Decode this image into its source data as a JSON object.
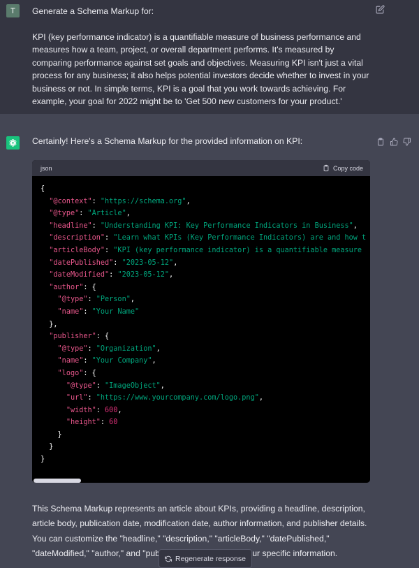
{
  "user": {
    "avatar_letter": "T",
    "title": "Generate a Schema Markup for:",
    "body": "KPI (key performance indicator) is a quantifiable measure of business performance and measures how a team, project, or overall department performs. It's measured by comparing performance against set goals and objectives. Measuring KPI isn't just a vital process for any business; it also helps potential investors decide whether to invest in your business or not. In simple terms, KPI is a goal that you work towards achieving. For example, your goal for 2022 might be to 'Get 500 new customers for your product.'"
  },
  "assistant": {
    "intro": "Certainly! Here's a Schema Markup for the provided information on KPI:",
    "code_language": "json",
    "copy_label": "Copy code",
    "code_lines": [
      [
        [
          "p",
          "{"
        ]
      ],
      [
        [
          "p",
          "  "
        ],
        [
          "k",
          "\"@context\""
        ],
        [
          "p",
          ": "
        ],
        [
          "s",
          "\"https://schema.org\""
        ],
        [
          "p",
          ","
        ]
      ],
      [
        [
          "p",
          "  "
        ],
        [
          "k",
          "\"@type\""
        ],
        [
          "p",
          ": "
        ],
        [
          "s",
          "\"Article\""
        ],
        [
          "p",
          ","
        ]
      ],
      [
        [
          "p",
          "  "
        ],
        [
          "k",
          "\"headline\""
        ],
        [
          "p",
          ": "
        ],
        [
          "s",
          "\"Understanding KPI: Key Performance Indicators in Business\""
        ],
        [
          "p",
          ","
        ]
      ],
      [
        [
          "p",
          "  "
        ],
        [
          "k",
          "\"description\""
        ],
        [
          "p",
          ": "
        ],
        [
          "s",
          "\"Learn what KPIs (Key Performance Indicators) are and how t"
        ]
      ],
      [
        [
          "p",
          "  "
        ],
        [
          "k",
          "\"articleBody\""
        ],
        [
          "p",
          ": "
        ],
        [
          "s",
          "\"KPI (key performance indicator) is a quantifiable measure"
        ]
      ],
      [
        [
          "p",
          "  "
        ],
        [
          "k",
          "\"datePublished\""
        ],
        [
          "p",
          ": "
        ],
        [
          "s",
          "\"2023-05-12\""
        ],
        [
          "p",
          ","
        ]
      ],
      [
        [
          "p",
          "  "
        ],
        [
          "k",
          "\"dateModified\""
        ],
        [
          "p",
          ": "
        ],
        [
          "s",
          "\"2023-05-12\""
        ],
        [
          "p",
          ","
        ]
      ],
      [
        [
          "p",
          "  "
        ],
        [
          "k",
          "\"author\""
        ],
        [
          "p",
          ": {"
        ]
      ],
      [
        [
          "p",
          "    "
        ],
        [
          "k",
          "\"@type\""
        ],
        [
          "p",
          ": "
        ],
        [
          "s",
          "\"Person\""
        ],
        [
          "p",
          ","
        ]
      ],
      [
        [
          "p",
          "    "
        ],
        [
          "k",
          "\"name\""
        ],
        [
          "p",
          ": "
        ],
        [
          "s",
          "\"Your Name\""
        ]
      ],
      [
        [
          "p",
          "  },"
        ]
      ],
      [
        [
          "p",
          "  "
        ],
        [
          "k",
          "\"publisher\""
        ],
        [
          "p",
          ": {"
        ]
      ],
      [
        [
          "p",
          "    "
        ],
        [
          "k",
          "\"@type\""
        ],
        [
          "p",
          ": "
        ],
        [
          "s",
          "\"Organization\""
        ],
        [
          "p",
          ","
        ]
      ],
      [
        [
          "p",
          "    "
        ],
        [
          "k",
          "\"name\""
        ],
        [
          "p",
          ": "
        ],
        [
          "s",
          "\"Your Company\""
        ],
        [
          "p",
          ","
        ]
      ],
      [
        [
          "p",
          "    "
        ],
        [
          "k",
          "\"logo\""
        ],
        [
          "p",
          ": {"
        ]
      ],
      [
        [
          "p",
          "      "
        ],
        [
          "k",
          "\"@type\""
        ],
        [
          "p",
          ": "
        ],
        [
          "s",
          "\"ImageObject\""
        ],
        [
          "p",
          ","
        ]
      ],
      [
        [
          "p",
          "      "
        ],
        [
          "k",
          "\"url\""
        ],
        [
          "p",
          ": "
        ],
        [
          "s",
          "\"https://www.yourcompany.com/logo.png\""
        ],
        [
          "p",
          ","
        ]
      ],
      [
        [
          "p",
          "      "
        ],
        [
          "k",
          "\"width\""
        ],
        [
          "p",
          ": "
        ],
        [
          "n",
          "600"
        ],
        [
          "p",
          ","
        ]
      ],
      [
        [
          "p",
          "      "
        ],
        [
          "k",
          "\"height\""
        ],
        [
          "p",
          ": "
        ],
        [
          "n",
          "60"
        ]
      ],
      [
        [
          "p",
          "    }"
        ]
      ],
      [
        [
          "p",
          "  }"
        ]
      ],
      [
        [
          "p",
          "}"
        ]
      ]
    ],
    "summary": "This Schema Markup represents an article about KPIs, providing a headline, description, article body, publication date, modification date, author information, and publisher details. You can customize the \"headline,\" \"description,\" \"articleBody,\" \"datePublished,\" \"dateModified,\" \"author,\" and \"publisher\" properties with your specific information."
  },
  "regenerate_label": "Regenerate response",
  "icons": {
    "edit": "edit-icon",
    "copy": "clipboard-icon",
    "thumbs_up": "thumbs-up-icon",
    "thumbs_down": "thumbs-down-icon",
    "regenerate": "refresh-icon",
    "assistant_logo": "openai-logo-icon"
  }
}
